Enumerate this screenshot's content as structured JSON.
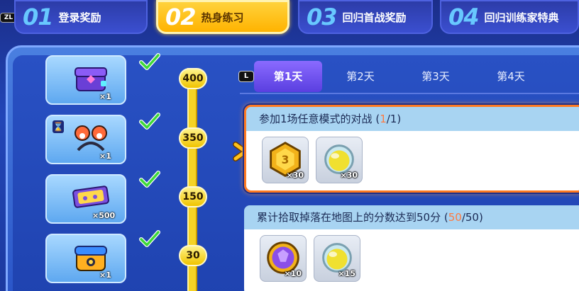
{
  "top_tabs": {
    "zl_label": "ZL",
    "items": [
      {
        "num": "01",
        "label": "登录奖励"
      },
      {
        "num": "02",
        "label": "热身练习"
      },
      {
        "num": "03",
        "label": "回归首战奖励"
      },
      {
        "num": "04",
        "label": "回归训练家特典"
      }
    ],
    "active_index": 1
  },
  "rewards": [
    {
      "qty": "×1",
      "icon": "purple-box-icon",
      "claimed": true
    },
    {
      "qty": "×1",
      "icon": "hair-clip-icon",
      "claimed": true
    },
    {
      "qty": "×500",
      "icon": "ticket-icon",
      "claimed": true
    },
    {
      "qty": "×1",
      "icon": "supply-crate-icon",
      "claimed": true
    }
  ],
  "milestones": [
    "400",
    "350",
    "150",
    "30"
  ],
  "days": {
    "l_label": "L",
    "items": [
      "第1天",
      "第2天",
      "第3天",
      "第4天"
    ],
    "active_index": 0
  },
  "tasks": [
    {
      "text": "参加1场任意模式的对战",
      "progress_open": "(",
      "progress_done": "1",
      "progress_total": "/1)",
      "items": [
        {
          "icon": "gold-coin-icon",
          "qty": "×30"
        },
        {
          "icon": "yellow-orb-icon",
          "qty": "×30"
        }
      ]
    },
    {
      "text": "累计拾取掉落在地图上的分数达到50分",
      "progress_open": "(",
      "progress_done": "50",
      "progress_total": "/50)",
      "items": [
        {
          "icon": "purple-coin-icon",
          "qty": "×10"
        },
        {
          "icon": "yellow-orb-icon",
          "qty": "×15"
        }
      ]
    }
  ],
  "colors": {
    "accent_yellow": "#ffd23c",
    "active_border": "#ff7a20",
    "day_active": "#6a4ff0",
    "progress_done": "#ff7a40"
  }
}
